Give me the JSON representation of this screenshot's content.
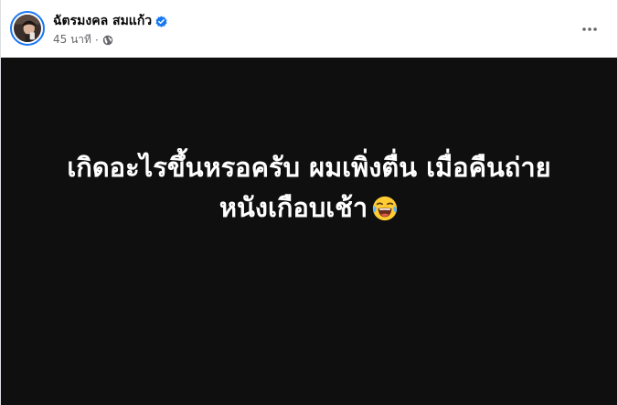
{
  "post": {
    "author": {
      "name": "ฉัตรมงคล สมแก้ว",
      "verified": true,
      "avatar_icon": "profile-photo"
    },
    "timestamp": "45 นาที",
    "separator": "·",
    "audience_icon": "globe-icon",
    "more_icon": "more-horizontal-icon",
    "media": {
      "background_color": "#0f0f0f",
      "text_color": "#ffffff",
      "line1": "เกิดอะไรขึ้นหรอครับ ผมเพิ่งตื่น เมื่อคืนถ่าย",
      "line2": "หนังเกือบเช้า",
      "emoji_icon": "face-with-tears-of-joy-icon"
    }
  },
  "colors": {
    "accent": "#1877f2",
    "secondary_text": "#65676b",
    "primary_text": "#050505"
  }
}
